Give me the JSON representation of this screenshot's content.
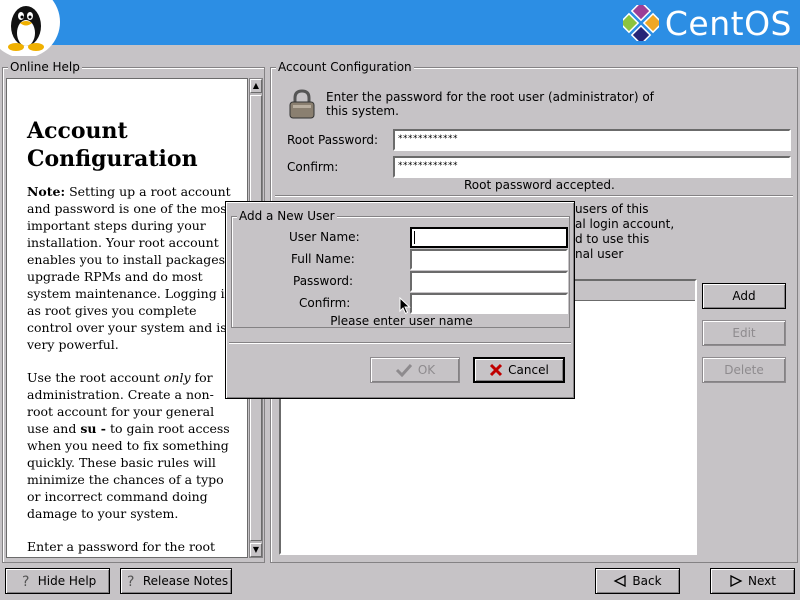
{
  "header": {
    "brand": "CentOS",
    "colors": {
      "bar": "#2c8ee4",
      "logo_purple": "#9c3f96",
      "logo_green": "#8cc43e",
      "logo_orange": "#efa724",
      "logo_blue": "#262577"
    }
  },
  "help": {
    "frame_label": "Online Help",
    "title_line1": "Account",
    "title_line2": "Configuration",
    "note_label": "Note:",
    "para1": " Setting up a root account and password is one of the most important steps during your installation. Your root account enables you to install packages, upgrade RPMs and do most system maintenance. Logging in as root gives you complete control over your system and is very powerful.",
    "para2_a": "Use the root account ",
    "para2_em": "only",
    "para2_b": " for administration. Create a non-root account for your general use and ",
    "para2_su": "su -",
    "para2_c": " to gain root access when you need to fix something quickly. These basic rules will minimize the chances of a typo or incorrect command doing damage to your system.",
    "para3": "Enter a password for the root account. The password must be at least six characters in length.",
    "scroll_up": "▲",
    "scroll_down": "▼"
  },
  "account": {
    "frame_label": "Account Configuration",
    "instruction": "Enter the password for the root user (administrator) of this system.",
    "root_password_label": "Root Password:",
    "root_password_value": "************",
    "confirm_label": "Confirm:",
    "confirm_value": "************",
    "accepted_text": "Root password accepted.",
    "partial_lines": [
      "users of this",
      "al login account,",
      "d to use this",
      "nal user"
    ],
    "add_label": "Add",
    "edit_label": "Edit",
    "delete_label": "Delete"
  },
  "dialog": {
    "frame_label": "Add a New User",
    "user_name_label": "User Name:",
    "full_name_label": "Full Name:",
    "password_label": "Password:",
    "confirm_label": "Confirm:",
    "status": "Please enter user name",
    "ok_label": "OK",
    "cancel_label": "Cancel"
  },
  "footer": {
    "hide_help_label": "Hide Help",
    "release_notes_label": "Release Notes",
    "back_label": "Back",
    "next_label": "Next"
  }
}
